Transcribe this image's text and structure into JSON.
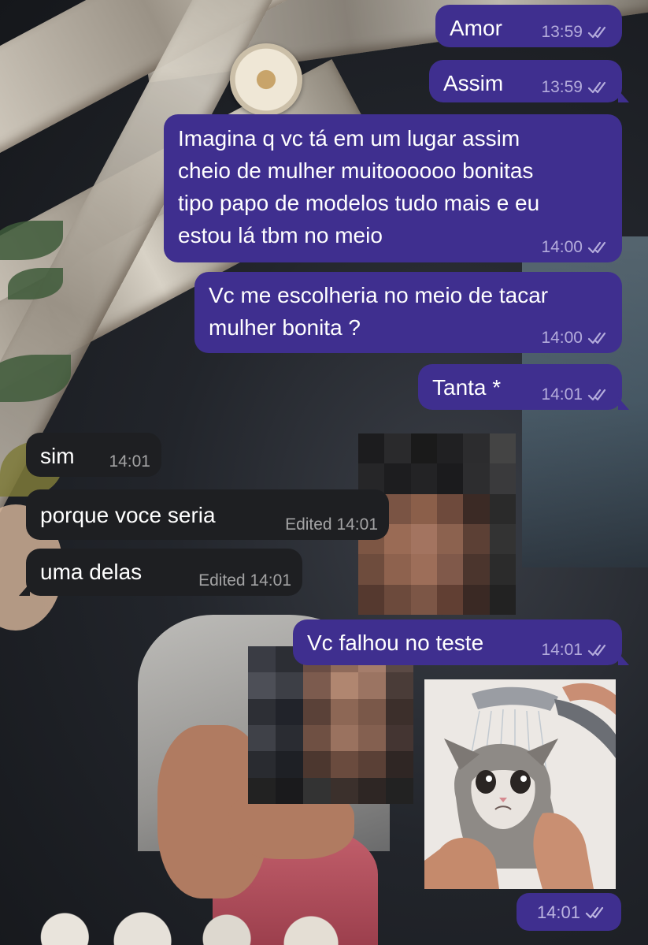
{
  "messages": [
    {
      "text": "Amor",
      "time": "13:59",
      "direction": "outgoing",
      "read": true
    },
    {
      "text": "Assim",
      "time": "13:59",
      "direction": "outgoing",
      "read": true
    },
    {
      "lines": [
        "Imagina q vc tá em um lugar assim",
        "cheio de mulher muitoooooo bonitas",
        "tipo papo de modelos tudo mais e eu",
        "estou lá tbm no meio"
      ],
      "time": "14:00",
      "direction": "outgoing",
      "read": true
    },
    {
      "lines": [
        "Vc me escolheria no meio de tacar",
        "mulher bonita ?"
      ],
      "time": "14:00",
      "direction": "outgoing",
      "read": true
    },
    {
      "text": "Tanta *",
      "time": "14:01",
      "direction": "outgoing",
      "read": true
    },
    {
      "text": "sim",
      "time": "14:01",
      "direction": "incoming"
    },
    {
      "text": "porque voce seria",
      "time": "Edited 14:01",
      "direction": "incoming"
    },
    {
      "text": "uma delas",
      "time": "Edited 14:01",
      "direction": "incoming"
    },
    {
      "text": "Vc falhou no teste",
      "time": "14:01",
      "direction": "outgoing",
      "read": true
    },
    {
      "sticker": "crying-wet-cat-sticker",
      "time": "14:01",
      "direction": "outgoing",
      "read": true
    }
  ],
  "colors": {
    "outgoing_bubble": "#3f2f8f",
    "incoming_bubble": "#1e1f22",
    "text": "#ffffff"
  },
  "icons": {
    "read_receipt": "double-check-icon"
  }
}
